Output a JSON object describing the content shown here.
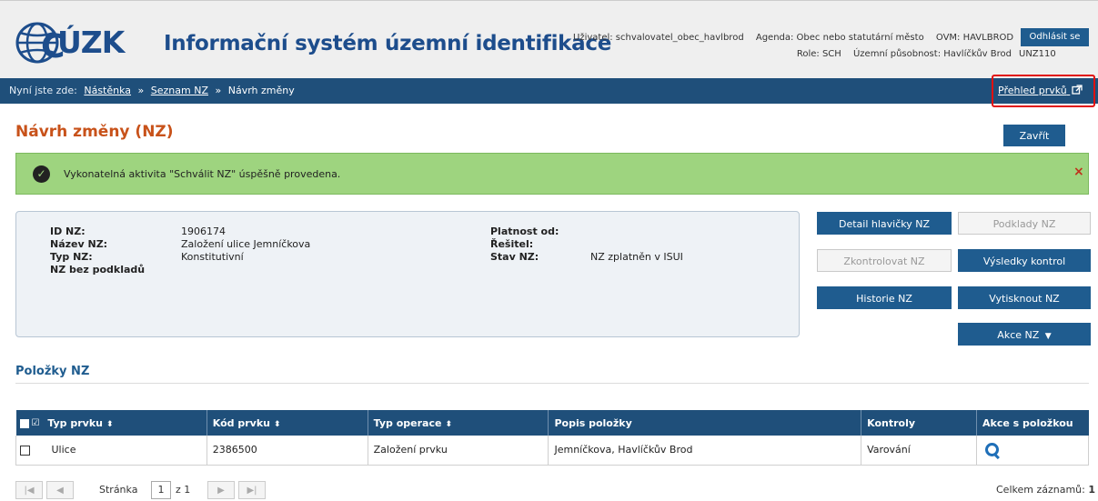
{
  "header": {
    "brand": "ÚZK",
    "app_title": "Informační systém územní identifikace",
    "user_label": "Uživatel: schvalovatel_obec_havlbrod",
    "agenda_label": "Agenda: Obec nebo statutární město",
    "ovm_label": "OVM: HAVLBROD",
    "role_label": "Role: SCH",
    "territory_label": "Územní působnost: Havlíčkův Brod",
    "logout_label": "Odhlásit se",
    "unz_label": "UNZ110"
  },
  "breadcrumb": {
    "prefix": "Nyní jste zde:",
    "items": [
      "Nástěnka",
      "Seznam NZ",
      "Návrh změny"
    ],
    "separator": "»",
    "overview_link": "Přehled prvků"
  },
  "page": {
    "title": "Návrh změny (NZ)",
    "close_label": "Zavřít"
  },
  "alert": {
    "message": "Vykonatelná aktivita \"Schválit NZ\" úspěšně provedena.",
    "close": "×"
  },
  "info": {
    "id_label": "ID NZ:",
    "id_value": "1906174",
    "name_label": "Název NZ:",
    "name_value": "Založení ulice Jemníčkova",
    "type_label": "Typ NZ:",
    "type_value": "Konstitutivní",
    "no_docs_label": "NZ bez podkladů",
    "valid_from_label": "Platnost od:",
    "valid_from_value": "",
    "solver_label": "Řešitel:",
    "solver_value": "",
    "state_label": "Stav NZ:",
    "state_value": "NZ zplatněn v ISUI"
  },
  "actions": {
    "detail_header": "Detail hlavičky NZ",
    "documents": "Podklady NZ",
    "check": "Zkontrolovat NZ",
    "check_results": "Výsledky kontrol",
    "history": "Historie NZ",
    "print": "Vytisknout NZ",
    "more": "Akce NZ"
  },
  "items_section": {
    "title": "Položky NZ",
    "columns": [
      "Typ prvku",
      "Kód prvku",
      "Typ operace",
      "Popis položky",
      "Kontroly",
      "Akce s položkou"
    ],
    "rows": [
      {
        "type": "Ulice",
        "code": "2386500",
        "operation": "Založení prvku",
        "description": "Jemníčkova, Havlíčkův Brod",
        "checks": "Varování"
      }
    ]
  },
  "pager": {
    "page_label": "Stránka",
    "page_value": "1",
    "of_label": "z 1",
    "total_label": "Celkem záznamů:",
    "total_value": "1"
  },
  "colors": {
    "brand_blue": "#1d4d8c",
    "nav_bar": "#1f4f7a",
    "button": "#1f5c8f",
    "title_orange": "#c8521a",
    "success": "#9ed47f",
    "highlight_box": "#e01010"
  }
}
